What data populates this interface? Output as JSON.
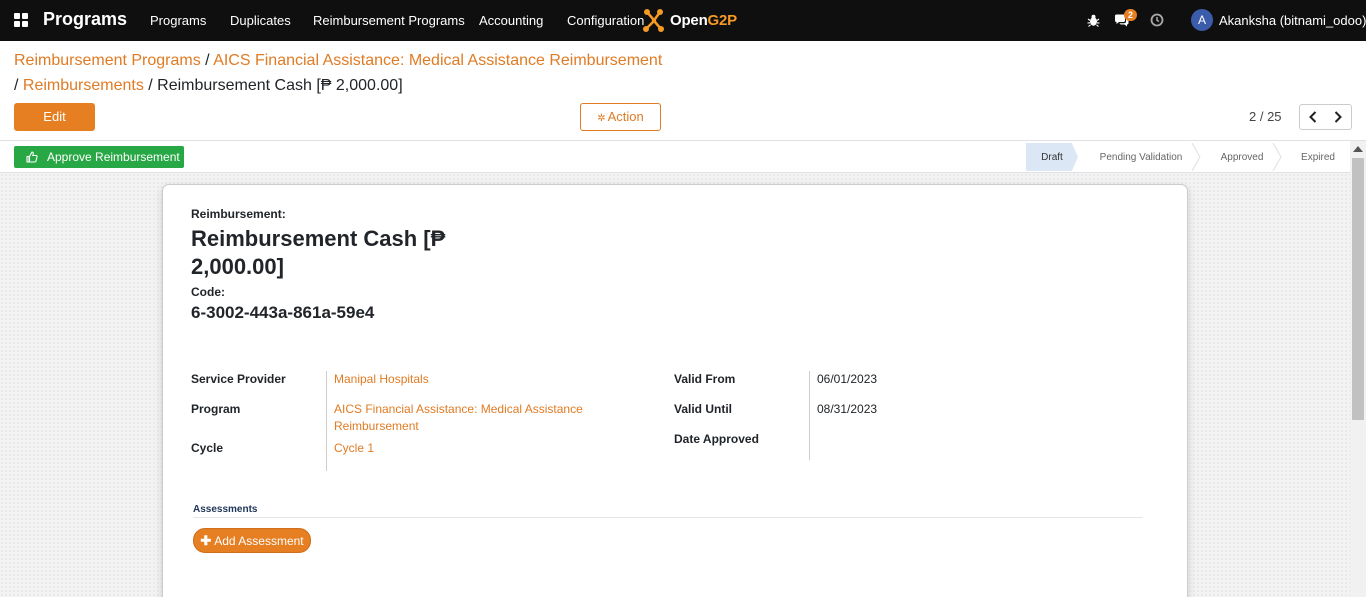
{
  "navbar": {
    "app_title": "Programs",
    "menu": [
      "Programs",
      "Duplicates",
      "Reimbursement Programs",
      "Accounting",
      "Configuration"
    ],
    "logo_text_white": "Open",
    "logo_text_accent": "G2P",
    "messages_badge": "2",
    "user_initial": "A",
    "user_name": "Akanksha (bitnami_odoo)",
    "icons": [
      "apps-icon",
      "bug-icon",
      "chat-icon",
      "clock-icon"
    ]
  },
  "breadcrumb": {
    "item1": "Reimbursement Programs",
    "sep1": " / ",
    "item2": "AICS Financial Assistance: Medical Assistance Reimbursement",
    "sep2": " / ",
    "item3": "Reimbursements",
    "sep3": " / ",
    "current": "Reimbursement Cash [₱ 2,000.00]"
  },
  "controls": {
    "edit_label": "Edit",
    "action_label": "Action",
    "pager": "2 / 25"
  },
  "statusbar": {
    "approve_label": "Approve Reimbursement",
    "stages": [
      "Draft",
      "Pending Validation",
      "Approved",
      "Expired"
    ],
    "active_stage": "Draft"
  },
  "record": {
    "reimbursement_label": "Reimbursement:",
    "title": "Reimbursement Cash [₱ 2,000.00]",
    "code_label": "Code:",
    "code": "6-3002-443a-861a-59e4",
    "left_fields": {
      "service_provider_label": "Service Provider",
      "service_provider": "Manipal Hospitals",
      "program_label": "Program",
      "program": "AICS Financial Assistance: Medical Assistance Reimbursement",
      "cycle_label": "Cycle",
      "cycle": "Cycle 1"
    },
    "right_fields": {
      "valid_from_label": "Valid From",
      "valid_from": "06/01/2023",
      "valid_until_label": "Valid Until",
      "valid_until": "08/31/2023",
      "date_approved_label": "Date Approved",
      "date_approved": ""
    },
    "assessments_title": "Assessments",
    "add_assessment_label": "Add Assessment"
  },
  "colors": {
    "accent": "#e67e22",
    "navbar": "#0f0f0f",
    "approve": "#28a745",
    "active_stage": "#dce7f5"
  }
}
